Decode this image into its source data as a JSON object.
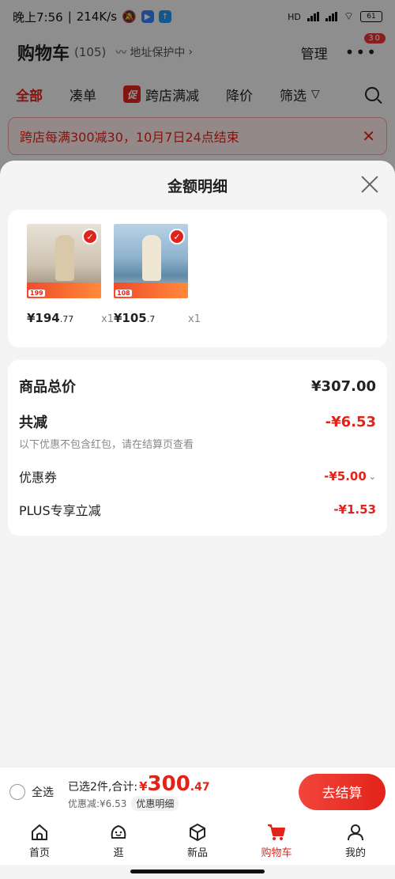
{
  "status_bar": {
    "time": "晚上7:56",
    "speed": "214K/s",
    "network": "HD",
    "battery": "61"
  },
  "cart_header": {
    "title": "购物车",
    "count": "(105)",
    "address_protect": "地址保护中",
    "manage": "管理",
    "message_badge": "30"
  },
  "filter_tabs": [
    {
      "label": "全部"
    },
    {
      "label": "凑单"
    },
    {
      "label": "跨店满减",
      "badge": "促"
    },
    {
      "label": "降价"
    },
    {
      "label": "筛选"
    }
  ],
  "promo_banner": {
    "text": "跨店每满300减30，10月7日24点结束"
  },
  "sheet": {
    "title": "金额明细",
    "products": [
      {
        "price_int": "¥194",
        "price_dec": ".77",
        "qty": "x1",
        "thumb_price": "199"
      },
      {
        "price_int": "¥105",
        "price_dec": ".7",
        "qty": "x1",
        "thumb_price": "108"
      }
    ],
    "summary": {
      "total_label": "商品总价",
      "total_value": "¥307.00",
      "reduce_label": "共减",
      "reduce_value": "-¥6.53",
      "hint": "以下优惠不包含红包，请在结算页查看",
      "coupon_label": "优惠券",
      "coupon_value": "-¥5.00",
      "plus_label": "PLUS专享立减",
      "plus_value": "-¥1.53"
    }
  },
  "checkout": {
    "select_all": "全选",
    "selected_prefix": "已选2件,合计:",
    "currency": "¥",
    "total_int": "300",
    "total_dec": ".47",
    "discount_text": "优惠减:¥6.53",
    "detail_chip": "优惠明细",
    "button": "去结算"
  },
  "tab_bar": [
    {
      "label": "首页"
    },
    {
      "label": "逛"
    },
    {
      "label": "新品"
    },
    {
      "label": "购物车"
    },
    {
      "label": "我的"
    }
  ],
  "colors": {
    "accent": "#e2231a",
    "overlay": "rgba(0,0,0,0.42)"
  }
}
